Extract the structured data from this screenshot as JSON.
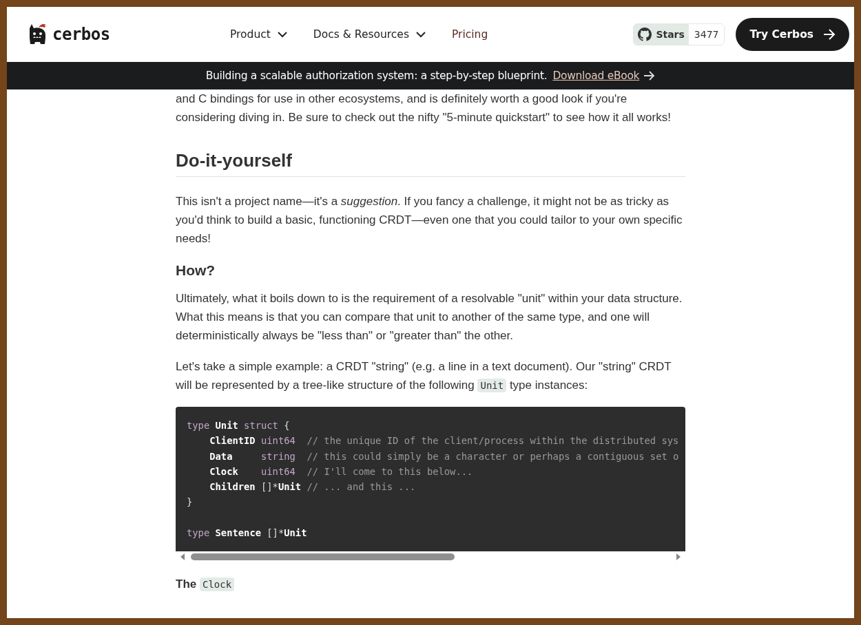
{
  "header": {
    "logo_text": "cerbos",
    "nav": [
      {
        "label": "Product",
        "dropdown": true
      },
      {
        "label": "Docs & Resources",
        "dropdown": true
      },
      {
        "label": "Pricing",
        "dropdown": false
      }
    ],
    "github": {
      "label": "Stars",
      "count": "3477"
    },
    "cta": "Try Cerbos"
  },
  "banner": {
    "text": "Building a scalable authorization system: a step-by-step blueprint.",
    "link": "Download eBook"
  },
  "article": [
    {
      "kind": "paragraph",
      "parts": [
        {
          "kind": "text",
          "text": "and C bindings for use in other ecosystems, and is definitely worth a good look if you're considering diving in. Be sure to check out the nifty \"5-minute quickstart\" to see how it all works!"
        }
      ]
    },
    {
      "kind": "h2",
      "parts": [
        {
          "kind": "text",
          "text": "Do-it-yourself"
        }
      ]
    },
    {
      "kind": "paragraph",
      "parts": [
        {
          "kind": "text",
          "text": "This isn't a project name—it's a *suggestion*. If you fancy a challenge, it might not be as tricky as you'd think to build a basic, functioning CRDT—even one that you could tailor to your own specific needs!"
        }
      ]
    },
    {
      "kind": "h3",
      "parts": [
        {
          "kind": "text",
          "text": "How?"
        }
      ]
    },
    {
      "kind": "paragraph",
      "parts": [
        {
          "kind": "text",
          "text": "Ultimately, what it boils down to is the requirement of a resolvable \"unit\" within your data structure. What this means is that you can compare that unit to another of the same type, and one will deterministically always be \"less than\" or \"greater than\" the other."
        }
      ]
    },
    {
      "kind": "paragraph",
      "parts": [
        {
          "kind": "text",
          "text": "Let's take a simple example: a CRDT \"string\" (e.g. a line in a text document). Our \"string\" CRDT will be represented by a tree-like structure of the following "
        },
        {
          "kind": "code",
          "text": "Unit"
        },
        {
          "kind": "text",
          "text": " type instances:"
        }
      ]
    },
    {
      "kind": "code_block",
      "lines": [
        {
          "indent": false,
          "tokens": [
            {
              "kind": "keyword",
              "text": "type"
            },
            {
              "kind": "ident",
              "text": " Unit"
            },
            {
              "kind": "keyword",
              "text": " struct"
            },
            {
              "kind": "plain",
              "text": " {"
            }
          ]
        },
        {
          "indent": true,
          "tokens": [
            {
              "kind": "ident",
              "text": "ClientID"
            },
            {
              "kind": "keyword",
              "text": " uint64"
            },
            {
              "kind": "comment",
              "text": "  // the unique ID of the client/process within the distributed sys"
            }
          ]
        },
        {
          "indent": true,
          "tokens": [
            {
              "kind": "ident",
              "text": "Data"
            },
            {
              "kind": "keyword",
              "text": "     string"
            },
            {
              "kind": "comment",
              "text": "  // this could simply be a character or perhaps a contiguous set o"
            }
          ]
        },
        {
          "indent": true,
          "tokens": [
            {
              "kind": "ident",
              "text": "Clock"
            },
            {
              "kind": "keyword",
              "text": "    uint64"
            },
            {
              "kind": "comment",
              "text": "  // I'll come to this below..."
            }
          ]
        },
        {
          "indent": true,
          "tokens": [
            {
              "kind": "ident",
              "text": "Children"
            },
            {
              "kind": "plain",
              "text": " []*"
            },
            {
              "kind": "ident",
              "text": "Unit"
            },
            {
              "kind": "comment",
              "text": " // ... and this ..."
            }
          ]
        },
        {
          "indent": false,
          "tokens": [
            {
              "kind": "plain",
              "text": "}"
            }
          ]
        },
        {
          "kind": "blank"
        },
        {
          "indent": false,
          "tokens": [
            {
              "kind": "keyword",
              "text": "type"
            },
            {
              "kind": "ident",
              "text": " Sentence"
            },
            {
              "kind": "plain",
              "text": " []*"
            },
            {
              "kind": "ident",
              "text": "Unit"
            }
          ]
        }
      ]
    },
    {
      "kind": "h4",
      "parts": [
        {
          "kind": "text",
          "text": "The "
        },
        {
          "kind": "code",
          "text": "Clock"
        }
      ]
    }
  ]
}
